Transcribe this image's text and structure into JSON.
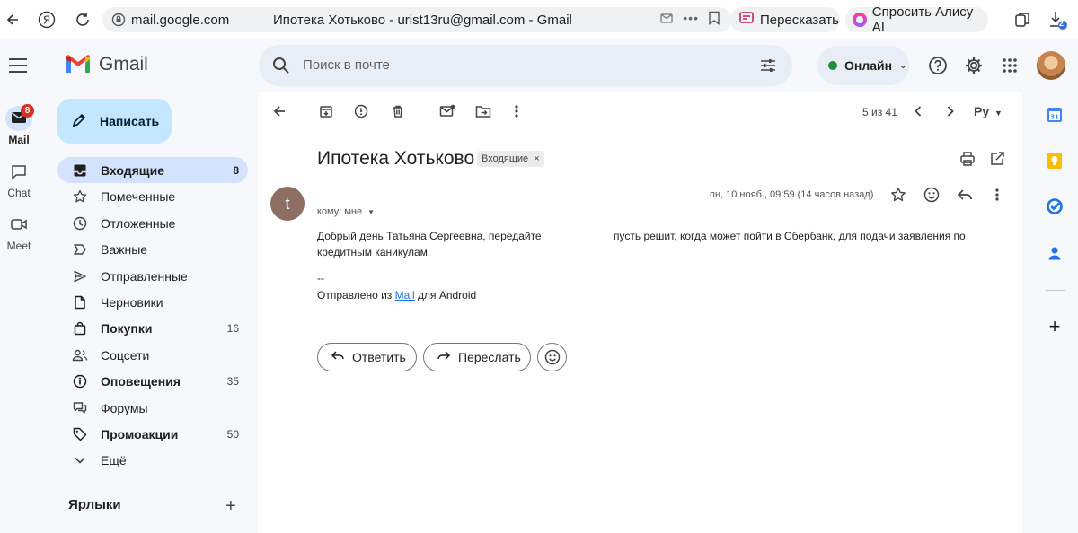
{
  "browser": {
    "url": "mail.google.com",
    "title": "Ипотека Хотьково - urist13ru@gmail.com - Gmail",
    "retell_label": "Пересказать",
    "alice_label": "Спросить Алису AI",
    "downloads_badge": "2"
  },
  "header": {
    "app_name": "Gmail",
    "search_placeholder": "Поиск в почте",
    "status_label": "Онлайн"
  },
  "rail": {
    "mail_label": "Mail",
    "mail_badge": "8",
    "chat_label": "Chat",
    "meet_label": "Meet"
  },
  "compose_label": "Написать",
  "folders": [
    {
      "label": "Входящие",
      "count": "8",
      "icon": "inbox-icon"
    },
    {
      "label": "Помеченные",
      "count": "",
      "icon": "star-icon"
    },
    {
      "label": "Отложенные",
      "count": "",
      "icon": "clock-icon"
    },
    {
      "label": "Важные",
      "count": "",
      "icon": "important-icon"
    },
    {
      "label": "Отправленные",
      "count": "",
      "icon": "send-icon"
    },
    {
      "label": "Черновики",
      "count": "",
      "icon": "draft-icon"
    },
    {
      "label": "Покупки",
      "count": "16",
      "icon": "shopping-bag-icon"
    },
    {
      "label": "Соцсети",
      "count": "",
      "icon": "people-icon"
    },
    {
      "label": "Оповещения",
      "count": "35",
      "icon": "info-icon"
    },
    {
      "label": "Форумы",
      "count": "",
      "icon": "forum-icon"
    },
    {
      "label": "Промоакции",
      "count": "50",
      "icon": "tag-icon"
    },
    {
      "label": "Ещё",
      "count": "",
      "icon": "chevron-down-icon"
    }
  ],
  "labels_heading": "Ярлыки",
  "toolbar": {
    "pager": "5 из 41",
    "language": "Ру"
  },
  "email": {
    "subject": "Ипотека Хотьково",
    "folder_tag": "Входящие",
    "sender_initial": "t",
    "recipient": "кому: мне",
    "date": "пн, 10 нояб., 09:59 (14 часов назад)",
    "body_line1_a": "Добрый день Татьяна Сергеевна, передайте",
    "body_line1_b": "пусть решит, когда может пойти в Сбербанк, для подачи заявления по",
    "body_line2": "кредитным каникулам.",
    "signature_sep": "--",
    "signature_prefix": "Отправлено из",
    "signature_link": "Mail",
    "signature_suffix": "для Android"
  },
  "actions": {
    "reply": "Ответить",
    "forward": "Переслать"
  }
}
